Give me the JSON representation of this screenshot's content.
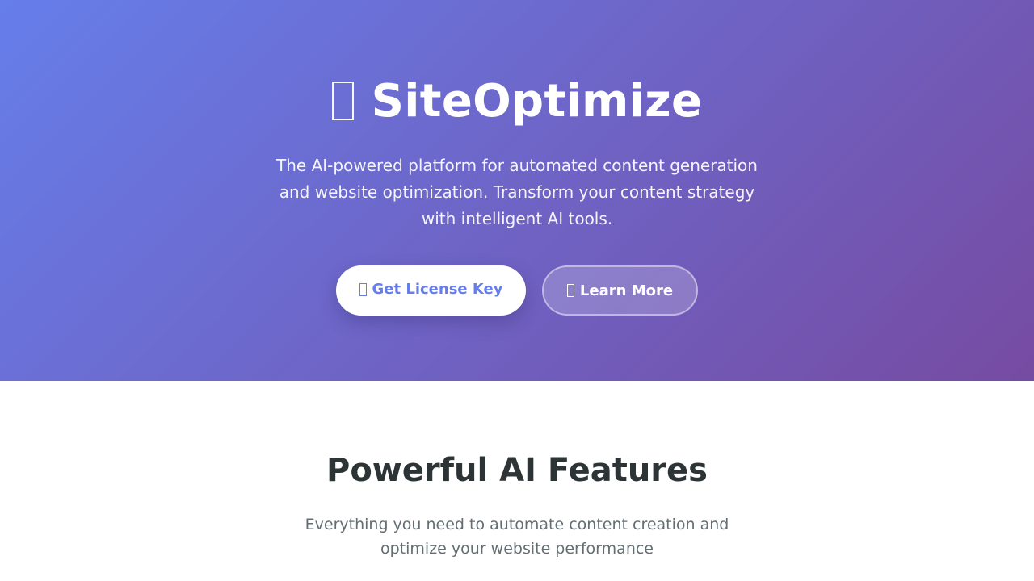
{
  "hero": {
    "title": "SiteOptimize",
    "title_icon": "rocket-icon",
    "subtitle": "The AI-powered platform for automated content generation and website optimization. Transform your content strategy with intelligent AI tools.",
    "primary_button": {
      "label": "Get License Key",
      "icon": "key-icon"
    },
    "secondary_button": {
      "label": "Learn More",
      "icon": "book-icon"
    },
    "gradient_start": "#667eea",
    "gradient_end": "#764ba2"
  },
  "features": {
    "title": "Powerful AI Features",
    "subtitle": "Everything you need to automate content creation and optimize your website performance"
  },
  "colors": {
    "accent": "#667eea",
    "heading": "#2d3436",
    "muted": "#636e72"
  }
}
